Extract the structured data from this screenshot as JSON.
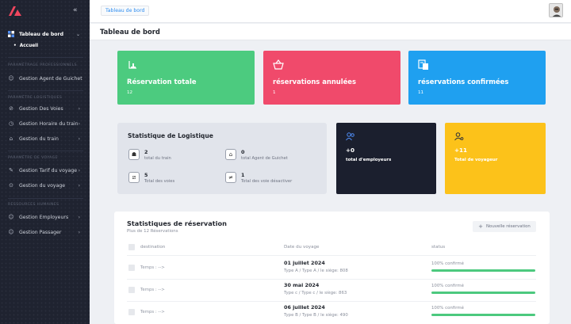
{
  "sidebar": {
    "menu": [
      {
        "label": "Tableau de bord",
        "icon": "dashboard-icon"
      },
      {
        "label": "Accueil"
      },
      {
        "label": "Gestion Agent de Guichet",
        "icon": "user-icon"
      },
      {
        "label": "Gestion Des Voies",
        "icon": "track-icon"
      },
      {
        "label": "Gestion Horaire du train",
        "icon": "clock-icon"
      },
      {
        "label": "Gestion du train",
        "icon": "train-icon"
      },
      {
        "label": "Gestion Tarif du voyage",
        "icon": "tag-icon"
      },
      {
        "label": "Gestion du voyage",
        "icon": "route-icon"
      },
      {
        "label": "Gestion Employeurs",
        "icon": "users-icon"
      },
      {
        "label": "Gestion Passager",
        "icon": "passenger-icon"
      }
    ],
    "sections": [
      "Paramètrage Professionnels",
      "Paramètre Logistiques",
      "Paramètre de voyage",
      "Ressources Humaines"
    ]
  },
  "topbar": {
    "breadcrumb": "Tableau de bord"
  },
  "page": {
    "title": "Tableau de bord"
  },
  "cards": [
    {
      "title": "Réservation totale",
      "value": "12",
      "color": "#4ccb7f",
      "icon": "stamp-icon"
    },
    {
      "title": "réservations annulées",
      "value": "1",
      "color": "#f04a6b",
      "icon": "basket-icon"
    },
    {
      "title": "réservations confirmées",
      "value": "11",
      "color": "#1fa0f0",
      "icon": "ticket-icon"
    }
  ],
  "logistique": {
    "title": "Statistique de Logistique",
    "stats": [
      {
        "value": "2",
        "label": "total du train",
        "icon": "train-icon"
      },
      {
        "value": "0",
        "label": "total Agent de Guichet",
        "icon": "bank-icon"
      },
      {
        "value": "5",
        "label": "Total des voies",
        "icon": "rail-icon"
      },
      {
        "value": "1",
        "label": "Total des voie désactiver",
        "icon": "not-equal-icon"
      }
    ]
  },
  "employees_card": {
    "value": "+0",
    "label": "total d'employeurs",
    "color": "#1b1f2e"
  },
  "travelers_card": {
    "value": "+11",
    "label": "Total de voyageur",
    "color": "#fcc21a"
  },
  "reservations": {
    "title": "Statistiques de réservation",
    "subtitle": "Plus de 12 Réservations",
    "new_button": "Nouvelle réservation",
    "columns": [
      "destination",
      "Date du voyage",
      "status"
    ],
    "rows": [
      {
        "destination": "Temps : -->",
        "date": "01 juillet 2024",
        "detail": "Type A / Type A / le siège: 808",
        "status": "100% confirmé",
        "progress": 1.0
      },
      {
        "destination": "Temps : -->",
        "date": "30 mai 2024",
        "detail": "Type c / Type c / le siège: 863",
        "status": "100% confirmé",
        "progress": 1.0
      },
      {
        "destination": "Temps : -->",
        "date": "06 juillet 2024",
        "detail": "Type B / Type B / le siège: 490",
        "status": "100% confirmé",
        "progress": 1.0
      }
    ]
  }
}
